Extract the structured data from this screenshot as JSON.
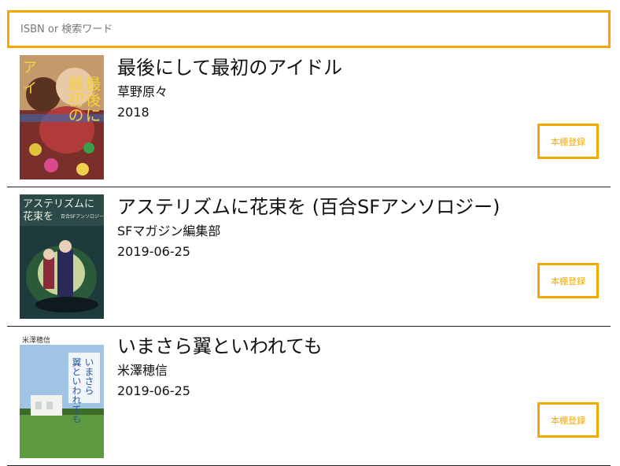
{
  "search": {
    "placeholder": "ISBN or 検索ワード",
    "value": ""
  },
  "accent_color": "#f5a800",
  "books": [
    {
      "title": "最後にして最初のアイドル",
      "author": "草野原々",
      "date": "2018",
      "button_label": "本棚登録",
      "cover_text": [
        "最後にして",
        "最初のアイドル"
      ]
    },
    {
      "title": "アステリズムに花束を (百合SFアンソロジー)",
      "author": "SFマガジン編集部",
      "date": "2019-06-25",
      "button_label": "本棚登録",
      "cover_text": [
        "アステリズムに",
        "花束を",
        "百合SFアンソロジー"
      ]
    },
    {
      "title": "いまさら翼といわれても",
      "author": "米澤穂信",
      "date": "2019-06-25",
      "button_label": "本棚登録",
      "cover_text": [
        "米澤穂信",
        "いまさら",
        "翼といわれても"
      ]
    }
  ]
}
